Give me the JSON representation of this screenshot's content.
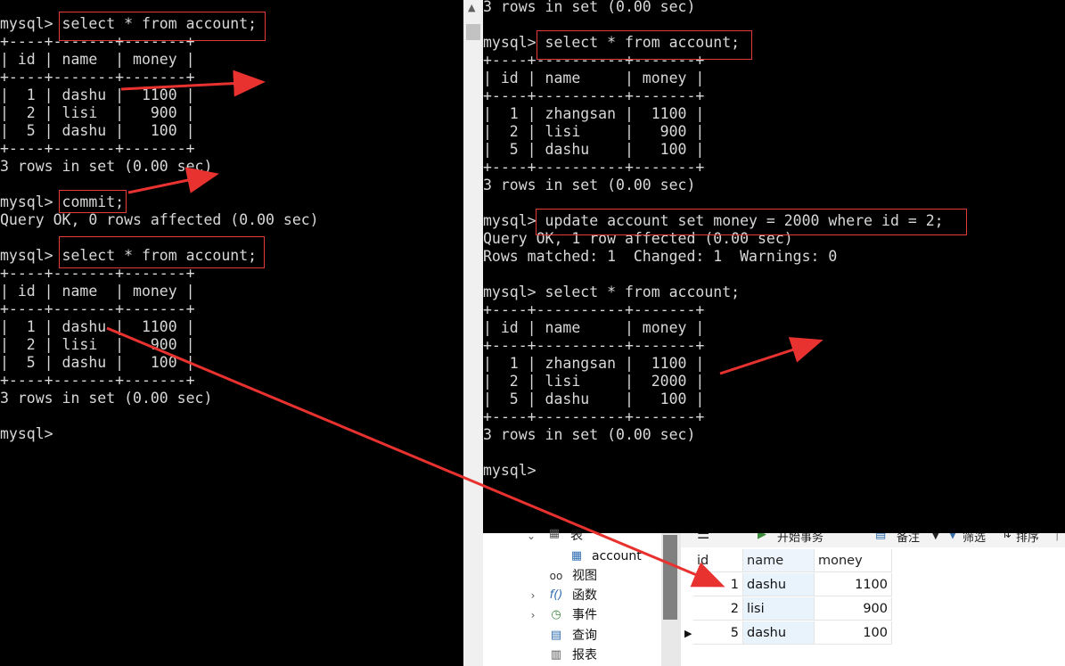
{
  "left_terminal": {
    "lines": [
      "mysql> select * from account;",
      "+----+-------+-------+",
      "| id | name  | money |",
      "+----+-------+-------+",
      "|  1 | dashu |  1100 |",
      "|  2 | lisi  |   900 |",
      "|  5 | dashu |   100 |",
      "+----+-------+-------+",
      "3 rows in set (0.00 sec)",
      "",
      "mysql> commit;",
      "Query OK, 0 rows affected (0.00 sec)",
      "",
      "mysql> select * from account;",
      "+----+-------+-------+",
      "| id | name  | money |",
      "+----+-------+-------+",
      "|  1 | dashu |  1100 |",
      "|  2 | lisi  |   900 |",
      "|  5 | dashu |   100 |",
      "+----+-------+-------+",
      "3 rows in set (0.00 sec)",
      "",
      "mysql>"
    ]
  },
  "right_terminal": {
    "lines": [
      "3 rows in set (0.00 sec)",
      "",
      "mysql> select * from account;",
      "+----+----------+-------+",
      "| id | name     | money |",
      "+----+----------+-------+",
      "|  1 | zhangsan |  1100 |",
      "|  2 | lisi     |   900 |",
      "|  5 | dashu    |   100 |",
      "+----+----------+-------+",
      "3 rows in set (0.00 sec)",
      "",
      "mysql> update account set money = 2000 where id = 2;",
      "Query OK, 1 row affected (0.00 sec)",
      "Rows matched: 1  Changed: 1  Warnings: 0",
      "",
      "mysql> select * from account;",
      "+----+----------+-------+",
      "| id | name     | money |",
      "+----+----------+-------+",
      "|  1 | zhangsan |  1100 |",
      "|  2 | lisi     |  2000 |",
      "|  5 | dashu    |   100 |",
      "+----+----------+-------+",
      "3 rows in set (0.00 sec)",
      "",
      "mysql>"
    ]
  },
  "navicat": {
    "tree": {
      "tables_label": "表",
      "table_name": "account",
      "views_label": "视图",
      "functions_label": "函数",
      "events_label": "事件",
      "queries_label": "查询",
      "reports_label": "报表"
    },
    "toolbar": {
      "begin_transaction": "开始事务",
      "notes": "备注",
      "filter": "筛选",
      "sort": "排序"
    },
    "grid": {
      "columns": [
        "id",
        "name",
        "money"
      ],
      "rows": [
        [
          "1",
          "dashu",
          "1100"
        ],
        [
          "2",
          "lisi",
          "900"
        ],
        [
          "5",
          "dashu",
          "100"
        ]
      ]
    }
  },
  "colors": {
    "terminal_bg": "#000000",
    "terminal_fg": "#d8d8d8",
    "highlight": "#e23b3b",
    "arrow": "#e8322f"
  }
}
